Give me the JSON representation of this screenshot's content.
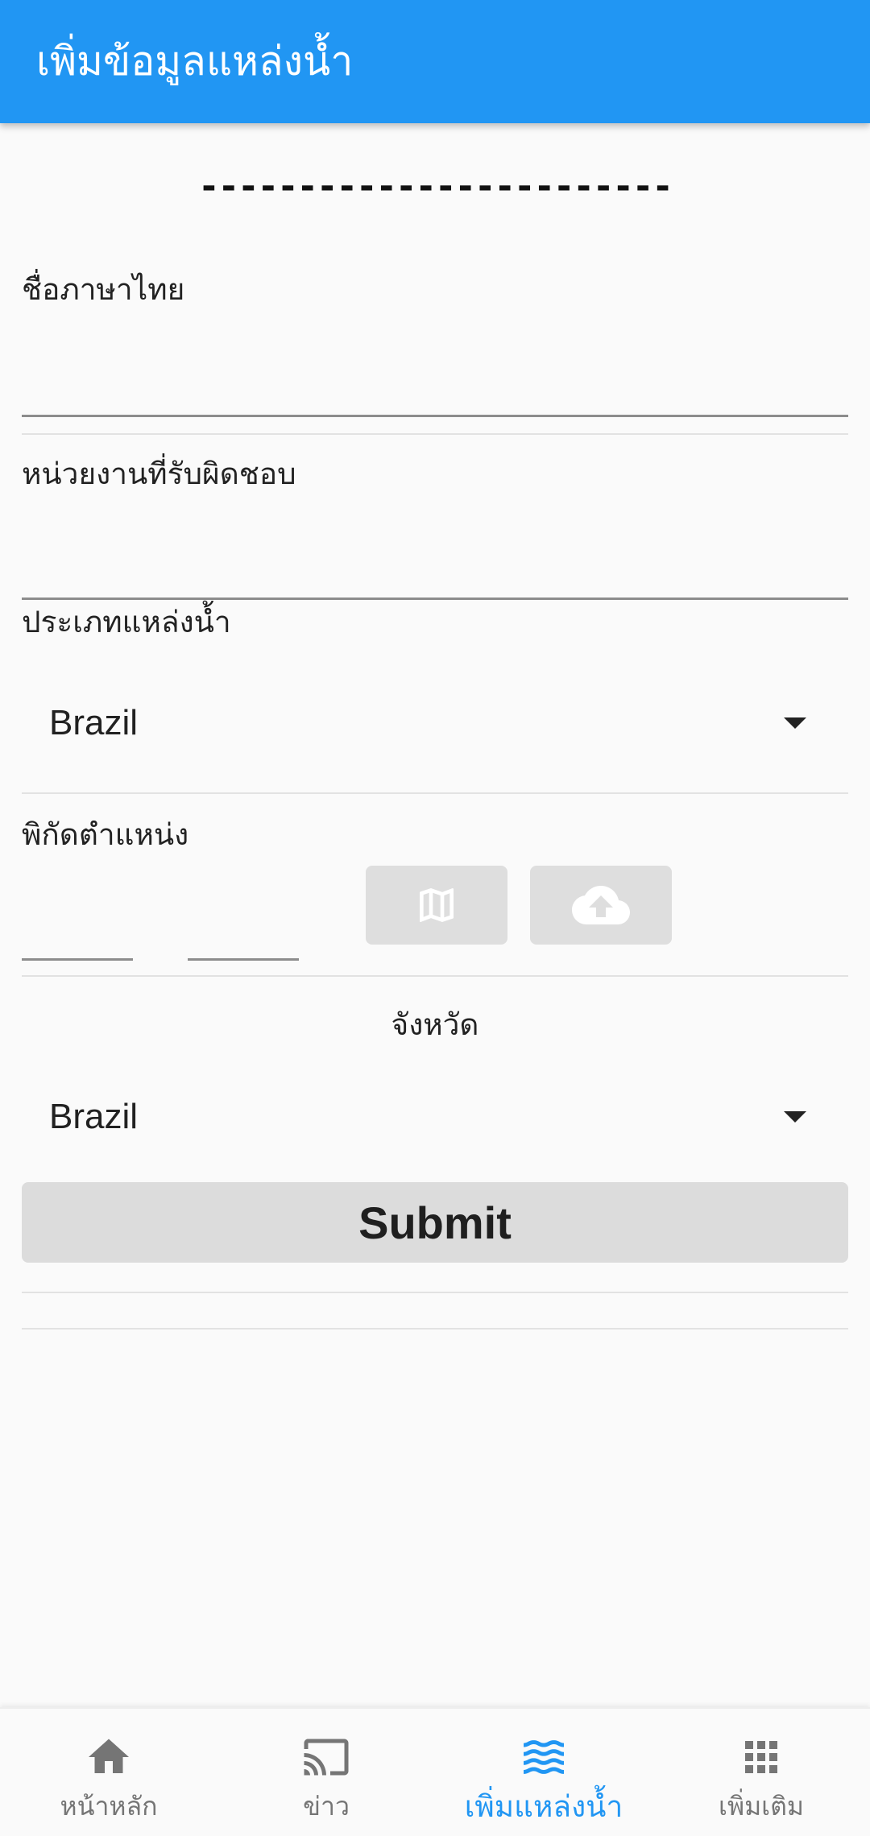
{
  "appbar": {
    "title": "เพิ่มข้อมูลแหล่งน้ำ"
  },
  "form": {
    "separator_text": "------------------------",
    "thai_name_label": "ชื่อภาษาไทย",
    "agency_label": "หน่วยงานที่รับผิดชอบ",
    "water_type_label": "ประเภทแหล่งน้ำ",
    "water_type_value": "Brazil",
    "coordinates_label": "พิกัดตำแหน่ง",
    "province_label": "จังหวัด",
    "province_value": "Brazil",
    "submit_label": "Submit"
  },
  "bottom_nav": {
    "items": [
      {
        "label": "หน้าหลัก",
        "icon": "home-icon"
      },
      {
        "label": "ข่าว",
        "icon": "cast-icon"
      },
      {
        "label": "เพิ่มแหล่งน้ำ",
        "icon": "waves-icon"
      },
      {
        "label": "เพิ่มเติม",
        "icon": "apps-icon"
      }
    ],
    "active_index": 2
  },
  "colors": {
    "primary": "#2196f3",
    "button_bg": "#dedede",
    "inactive_nav": "#757575"
  }
}
